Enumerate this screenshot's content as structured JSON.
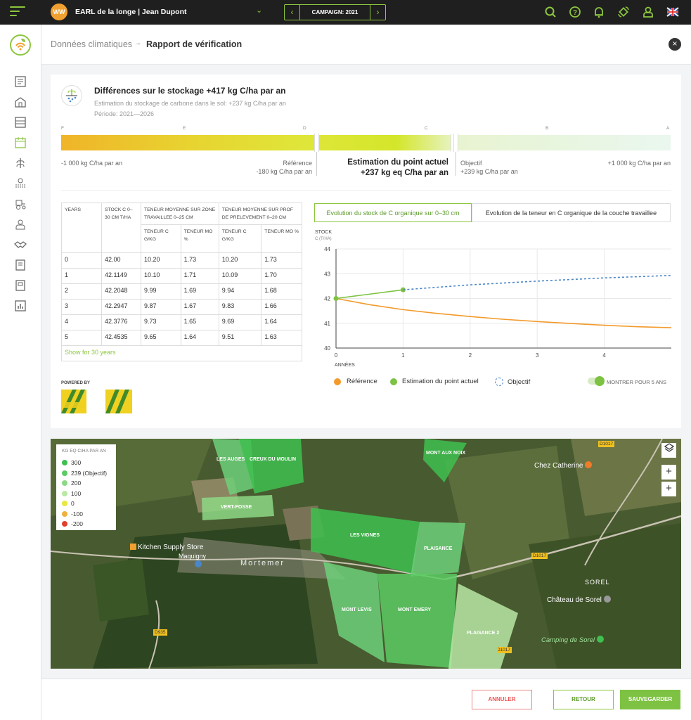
{
  "topbar": {
    "avatar_initials": "WW",
    "farm_name": "EARL de la longe | Jean Dupont",
    "campaign_label": "CAMPAIGN: 2021",
    "icons": [
      "search-icon",
      "help-icon",
      "bell-icon",
      "satellite-icon",
      "user-icon",
      "uk-flag-icon"
    ],
    "accent_color": "#8cc63f"
  },
  "breadcrumb": {
    "parent": "Données climatiques",
    "current": "Rapport de vérification"
  },
  "summary": {
    "title": "Différences sur le stockage +417 kg C/ha par an",
    "subtitle": "Estimation du stockage de carbone dans le sol: +237 kg C/ha par an",
    "period": "Période: 2021—2026",
    "grades": [
      "F",
      "E",
      "D",
      "C",
      "B",
      "A"
    ],
    "min_label": "-1 000 kg C/ha par an",
    "max_label": "+1 000 kg C/ha par an",
    "reference_title": "Référence",
    "reference_value": "-180 kg C/ha par an",
    "estimation_title": "Estimation du point actuel",
    "estimation_value": "+237 kg eq C/ha par an",
    "objective_title": "Objectif",
    "objective_value": "+239 kg C/ha par an"
  },
  "table": {
    "headers": {
      "years": "YEARS",
      "stock": "STOCK C 0–30 CM T/HA",
      "zone": "TENEUR MOYENNE SUR ZONE TRAVAILLEE 0–25 CM",
      "prof": "TENEUR MOYENNE SUR PROF DE PRELEVEMENT 0–20 CM",
      "c": "TENEUR C G/KG",
      "mo": "TENEUR MO %"
    },
    "rows": [
      [
        "0",
        "42.00",
        "10.20",
        "1.73",
        "10.20",
        "1.73"
      ],
      [
        "1",
        "42.1149",
        "10.10",
        "1.71",
        "10.09",
        "1.70"
      ],
      [
        "2",
        "42.2048",
        "9.99",
        "1.69",
        "9.94",
        "1.68"
      ],
      [
        "3",
        "42.2947",
        "9.87",
        "1.67",
        "9.83",
        "1.66"
      ],
      [
        "4",
        "42.3776",
        "9.73",
        "1.65",
        "9.69",
        "1.64"
      ],
      [
        "5",
        "42.4535",
        "9.65",
        "1.64",
        "9.51",
        "1.63"
      ]
    ],
    "show_more": "Show for 30 years"
  },
  "powered_by": "POWERED BY",
  "tabs": [
    "Evolution du stock de C organique sur 0–30 cm",
    "Evolution de la teneur en C organique de la couche travaillee"
  ],
  "chart_data": {
    "type": "line",
    "ylabel_line1": "STOCK",
    "ylabel_line2": "C (T/HA)",
    "xlabel": "ANNÉES",
    "ylim": [
      40,
      44
    ],
    "xlim": [
      0,
      5
    ],
    "yticks": [
      "40",
      "41",
      "42",
      "43",
      "44"
    ],
    "xticks": [
      "0",
      "1",
      "2",
      "3",
      "4"
    ],
    "series": [
      {
        "name": "Référence",
        "color": "#f39a2b",
        "style": "solid",
        "x": [
          0,
          0.5,
          1,
          1.5,
          2,
          2.5,
          3,
          3.5,
          4,
          4.5,
          5
        ],
        "y": [
          42.0,
          41.75,
          41.55,
          41.4,
          41.27,
          41.16,
          41.07,
          40.99,
          40.92,
          40.86,
          40.82
        ]
      },
      {
        "name": "Estimation du point actuel",
        "color": "#7dc242",
        "style": "solid",
        "x": [
          0,
          1
        ],
        "y": [
          42.0,
          42.35
        ]
      },
      {
        "name": "Objectif",
        "color": "#4a86c8",
        "style": "dashed",
        "x": [
          1,
          2,
          3,
          4,
          5
        ],
        "y": [
          42.35,
          42.55,
          42.7,
          42.83,
          42.93
        ]
      }
    ],
    "toggle_label": "MONTRER POUR 5 ANS"
  },
  "map": {
    "legend_title": "KG EQ C/HA PAR AN",
    "legend": [
      {
        "label": "300",
        "color": "#3fbf4f"
      },
      {
        "label": "239 (Objectif)",
        "color": "#5ccb63"
      },
      {
        "label": "200",
        "color": "#8dd885"
      },
      {
        "label": "100",
        "color": "#b8e8a4"
      },
      {
        "label": "0",
        "color": "#e8e840"
      },
      {
        "label": "-100",
        "color": "#f0b040"
      },
      {
        "label": "-200",
        "color": "#e04030"
      }
    ],
    "fields": [
      "LES AUGES",
      "CREUX DU MOULIN",
      "MONT AUX NOIX",
      "VERT-FOSSE",
      "LES VIGNES",
      "PLAISANCE",
      "MONT LEVIS",
      "MONT EMERY",
      "PLAISANCE 2"
    ],
    "places": [
      "Chez Catherine",
      "Kitchen Supply Store",
      "Maquigny",
      "Mortemer",
      "SOREL",
      "Château de Sorel",
      "Camping de Sorel",
      "D1017",
      "D1017",
      "D935",
      "D1017"
    ]
  },
  "footer": {
    "cancel": "ANNULER",
    "back": "RETOUR",
    "save": "SAUVEGARDER"
  }
}
